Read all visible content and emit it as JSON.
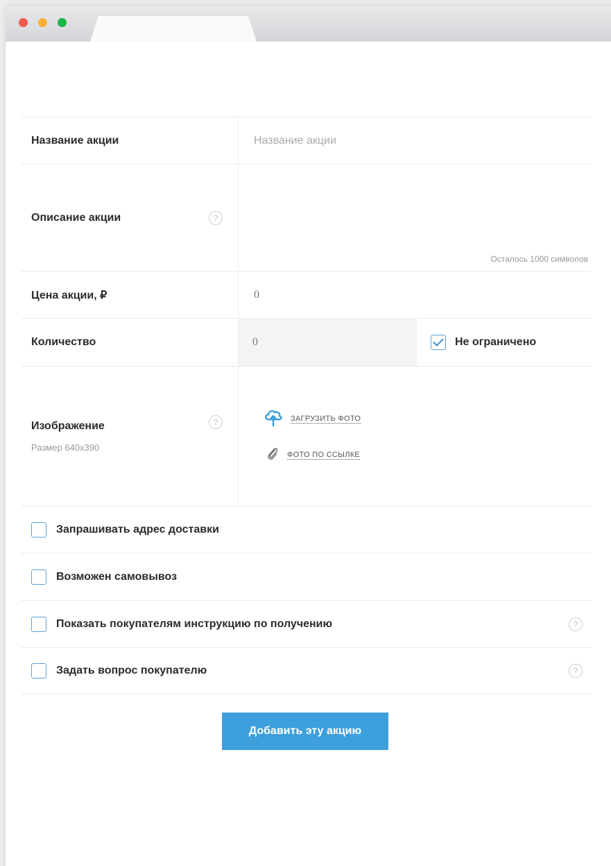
{
  "window": {
    "colors": {
      "red": "#ee5a4f",
      "yellow": "#f6b03a",
      "green": "#1bb74a"
    }
  },
  "form": {
    "name": {
      "label": "Название акции",
      "placeholder": "Название акции"
    },
    "description": {
      "label": "Описание акции",
      "help": "?",
      "counter": "Осталось 1000 символов"
    },
    "price": {
      "label": "Цена акции, ₽",
      "value": "0"
    },
    "quantity": {
      "label": "Количество",
      "value": "0",
      "unlimited_label": "Не ограничено",
      "unlimited_checked": true
    },
    "image": {
      "label": "Изображение",
      "size_hint": "Размер 640x390",
      "help": "?",
      "upload_label": "ЗАГРУЗИТЬ ФОТО",
      "url_label": "ФОТО ПО ССЫЛКЕ"
    },
    "options": [
      {
        "label": "Запрашивать адрес доставки",
        "checked": false,
        "help": ""
      },
      {
        "label": "Возможен самовывоз",
        "checked": false,
        "help": ""
      },
      {
        "label": "Показать покупателям инструкцию по получению",
        "checked": false,
        "help": "?"
      },
      {
        "label": "Задать вопрос покупателю",
        "checked": false,
        "help": "?"
      }
    ],
    "submit_label": "Добавить эту акцию"
  }
}
